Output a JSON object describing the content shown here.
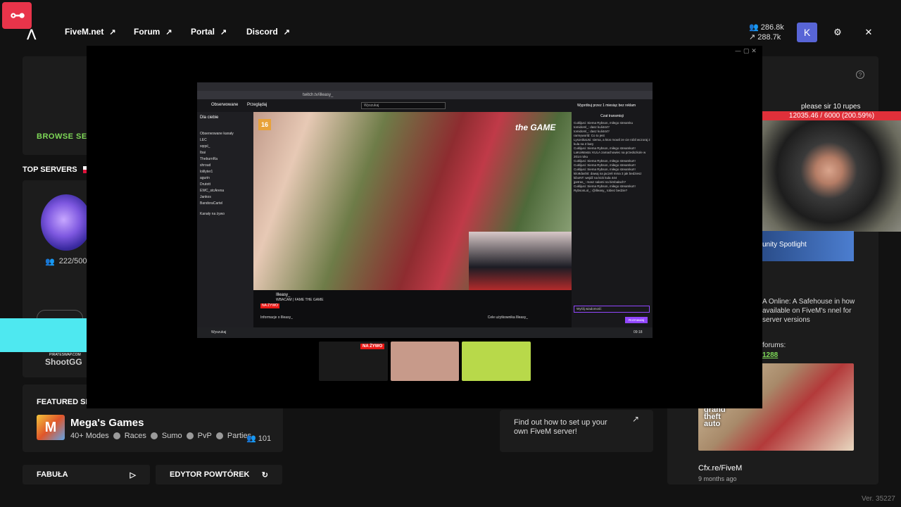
{
  "app": {
    "logo_text": "⊶"
  },
  "nav": [
    {
      "label": "FiveM.net",
      "arrow": "↗"
    },
    {
      "label": "Forum",
      "arrow": "↗"
    },
    {
      "label": "Portal",
      "arrow": "↗"
    },
    {
      "label": "Discord",
      "arrow": "↗"
    }
  ],
  "stats": {
    "players": "286.8k",
    "servers": "288.7k"
  },
  "user": {
    "avatar_letter": "K"
  },
  "left": {
    "browse_servers": "BROWSE SER",
    "top_servers": "TOP SERVERS",
    "server_players": "222/500",
    "cyan_caption": "PIRATESWAP.COM",
    "shootgg": "ShootGG",
    "featured_title": "FEATURED SE",
    "featured": {
      "name": "Mega's Games",
      "modes": "40+ Modes",
      "tags": [
        "Races",
        "Sumo",
        "PvP",
        "Parties"
      ],
      "count": "101",
      "logo": "M"
    },
    "fabula": "FABUŁA",
    "editor": "EDYTOR POWTÓREK"
  },
  "center": {
    "setup_text": "Find out how to set up your own FiveM server!"
  },
  "right": {
    "streamer_caption": "please sir 10 rupes",
    "donation": "12035.46 / 6000 (200.59%)",
    "community": "unity Spotlight",
    "news": "A Online: A Safehouse in how available on FiveM's nnel for server versions",
    "forums_label": "forums:",
    "forums_link": "1288",
    "gta_logo": "grand theft auto",
    "cfx_title": "Cfx.re/FiveM",
    "cfx_time": "9 months ago",
    "version": "Ver. 35227"
  },
  "overlay": {
    "controls": "— ▢ ✕",
    "address": "twitch.tv/illeasy_",
    "nav_followed": "Obserwowane",
    "nav_browse": "Przeglądaj",
    "search_placeholder": "Wyszukaj",
    "promo": "Wypróbuj przez 1 miesiąc bez reklam",
    "side_title": "Dla ciebie",
    "side_section": "Obserwowane kanały",
    "side_channels": [
      "LEC",
      "xqqsl_",
      "Ibai",
      "TheburnRa",
      "shroud",
      "lolilyter1",
      "agurin",
      "Drutott",
      "EWC_stcArena",
      "Jankos",
      "BandoraCartel"
    ],
    "side_live": "Kanały na żywo",
    "age_rating": "16",
    "game_logo": "the GAME",
    "streamer": "Illeasy_",
    "stream_title": "WBACAM | FAME THE GAME",
    "live_badge": "NA ŻYWO",
    "info_label": "Informacje o Illeasy_",
    "goal_label": "Cele użytkownika Illeasy_",
    "chat_title": "Czat transmisji",
    "chat_lines": [
      "Cuklijusi: Siema Rybson, miłego streamku",
      "tomidoml_: dasz kuli444?",
      "tomidoml_: dasz kuli444?",
      "rarmyworld: Co to jest",
      "LysonikaUsi: siema, a ktos mowil ze cie robil wczoraj z kula na 2 bary",
      "Cuklijusi: Siema Rybson, miłego streamku!!!",
      "LaKoiMasta: KULA zamachowiec na przedszkole w 2014 roku",
      "Cuklijusi: Siema Rybson, miłego streamku!!!",
      "Cuklijusi: Siema Rybson, miłego streamku!!!",
      "Cuklijusi: Siema Rybson, miłego streamku!!!",
      "kilo9dashit: dawaj na jaczeli mma 3 jak bedziesz",
      "kiboNT: wejdź na kick kula 444",
      "jpetras_: masz salami na bimbałach?",
      "Cuklijusi: Siema Rybson, miłego streamku!!!",
      "RybsonLol_: @illeasy_ tobiez bedzie?"
    ],
    "chat_input": "Wyślij wiadomość",
    "chat_button": "Rozmawiaj",
    "taskbar_search": "Wyszukaj",
    "taskbar_time": "09:18",
    "thumb_live": "NA ŻYWO"
  },
  "colors": {
    "accent_green": "#7ed957",
    "brand_red": "#e8344a",
    "avatar_blue": "#5865d6",
    "twitch_purple": "#9146ff"
  }
}
